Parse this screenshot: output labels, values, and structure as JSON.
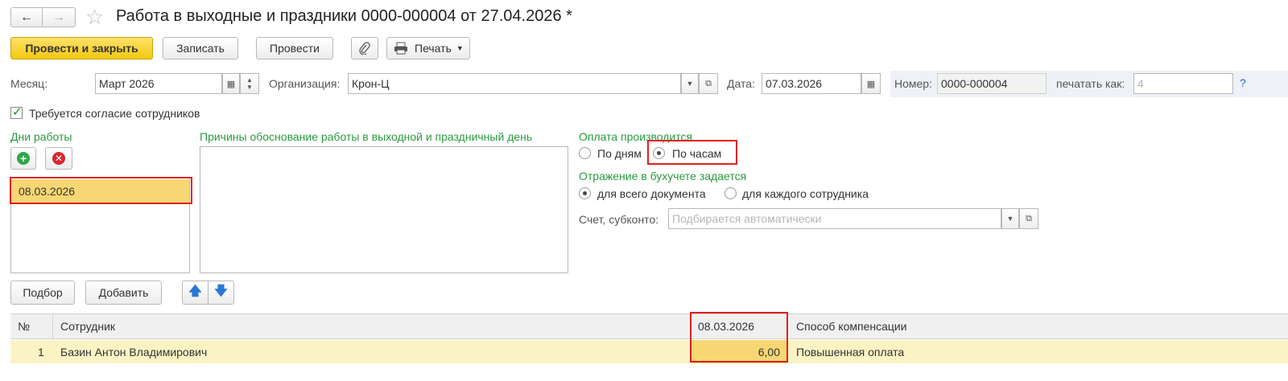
{
  "header": {
    "back_icon": "arrow-left-icon",
    "forward_icon": "arrow-right-icon",
    "favorite_icon": "star-icon",
    "title": "Работа в выходные и праздники 0000-000004 от 27.04.2026 *"
  },
  "toolbar": {
    "post_close_label": "Провести и закрыть",
    "save_label": "Записать",
    "post_label": "Провести",
    "attach_icon": "paperclip-icon",
    "print_label": "Печать",
    "print_icon": "printer-icon"
  },
  "fields": {
    "month_label": "Месяц:",
    "month_value": "Март 2026",
    "org_label": "Организация:",
    "org_value": "Крон-Ц",
    "date_label": "Дата:",
    "date_value": "07.03.2026",
    "number_label": "Номер:",
    "number_value": "0000-000004",
    "print_as_label": "печатать как:",
    "print_as_placeholder": "4",
    "help": "?"
  },
  "consent": {
    "checked": true,
    "label": "Требуется согласие сотрудников"
  },
  "work_days": {
    "title": "Дни работы",
    "items": [
      "08.03.2026"
    ]
  },
  "reasons": {
    "title": "Причины обоснование работы в выходной и праздничный день",
    "value": ""
  },
  "payment": {
    "title": "Оплата производится",
    "options": [
      "По дням",
      "По часам"
    ],
    "selected": "По часам"
  },
  "accounting": {
    "title": "Отражение в бухучете задается",
    "options": [
      "для всего документа",
      "для каждого сотрудника"
    ],
    "selected": "для всего документа",
    "account_label": "Счет, субконто:",
    "account_placeholder": "Подбирается автоматически"
  },
  "table_toolbar": {
    "select_label": "Подбор",
    "add_label": "Добавить",
    "up_icon": "arrow-up-icon",
    "down_icon": "arrow-down-icon"
  },
  "table": {
    "columns": [
      "№",
      "Сотрудник",
      "08.03.2026",
      "Способ компенсации"
    ],
    "rows": [
      {
        "num": "1",
        "employee": "Базин Антон Владимирович",
        "hours": "6,00",
        "compensation": "Повышенная оплата"
      }
    ]
  },
  "colors": {
    "accent_green": "#2a9a3e",
    "primary_button": "#f3c90f",
    "highlight_row": "#faf3c4",
    "selected_cell": "#f7d774",
    "annotation_red": "#e02020"
  }
}
